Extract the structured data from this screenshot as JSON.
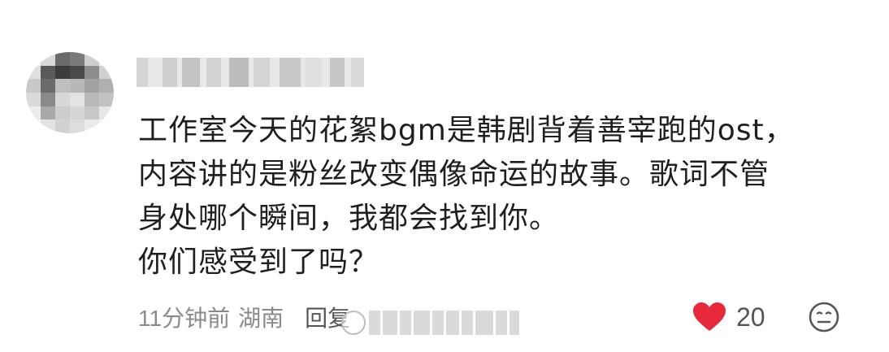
{
  "comment": {
    "username": "",
    "lines": [
      "工作室今天的花絮bgm是韩剧背着善宰跑的ost，",
      "内容讲的是粉丝改变偶像命运的故事。歌词不管",
      "身处哪个瞬间，我都会找到你。",
      "你们感受到了吗？"
    ],
    "time": "11分钟前",
    "location": "湖南",
    "reply_label": "回复",
    "like_count": "20",
    "liked": true,
    "like_color": "#e8293b",
    "icons": {
      "like": "heart-icon",
      "reaction": "emoji-face-icon"
    }
  }
}
